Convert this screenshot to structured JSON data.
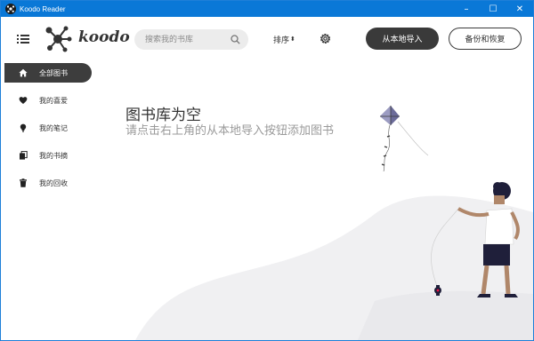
{
  "window": {
    "title": "Koodo Reader",
    "controls": [
      "–",
      "☐",
      "✕"
    ]
  },
  "header": {
    "logo_text": "koodo",
    "search_placeholder": "搜索我的书库",
    "sort_label": "排序",
    "import_button": "从本地导入",
    "backup_button": "备份和恢复"
  },
  "sidebar": {
    "items": [
      {
        "label": "全部图书",
        "icon": "home-icon",
        "active": true
      },
      {
        "label": "我的喜爱",
        "icon": "heart-icon",
        "active": false
      },
      {
        "label": "我的笔记",
        "icon": "lightbulb-icon",
        "active": false
      },
      {
        "label": "我的书摘",
        "icon": "copy-icon",
        "active": false
      },
      {
        "label": "我的回收",
        "icon": "trash-icon",
        "active": false
      }
    ]
  },
  "main": {
    "empty_title": "图书库为空",
    "empty_desc": "请点击右上角的从本地导入按钮添加图书"
  },
  "colors": {
    "titlebar": "#0a78d7",
    "primary_dark": "#3a3a3a",
    "kite_accent": "#6c6c9a"
  }
}
